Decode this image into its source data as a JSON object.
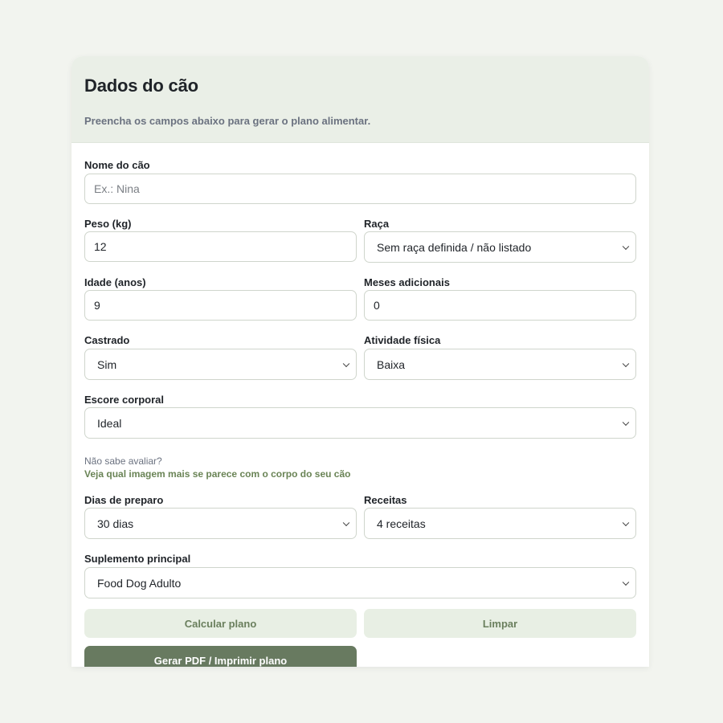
{
  "header": {
    "title": "Dados do cão",
    "subtitle": "Preencha os campos abaixo para gerar o plano alimentar."
  },
  "form": {
    "nome": {
      "label": "Nome do cão",
      "placeholder": "Ex.: Nina",
      "value": ""
    },
    "peso": {
      "label": "Peso (kg)",
      "value": "12"
    },
    "raca": {
      "label": "Raça",
      "value": "Sem raça definida / não listado"
    },
    "idade": {
      "label": "Idade (anos)",
      "value": "9"
    },
    "meses": {
      "label": "Meses adicionais",
      "value": "0"
    },
    "castrado": {
      "label": "Castrado",
      "value": "Sim"
    },
    "atividade": {
      "label": "Atividade física",
      "value": "Baixa"
    },
    "escore": {
      "label": "Escore corporal",
      "value": "Ideal"
    },
    "escore_hint": {
      "question": "Não sabe avaliar?",
      "link": "Veja qual imagem mais se parece com o corpo do seu cão"
    },
    "dias": {
      "label": "Dias de preparo",
      "value": "30 dias"
    },
    "receitas": {
      "label": "Receitas",
      "value": "4 receitas"
    },
    "suplemento": {
      "label": "Suplemento principal",
      "value": "Food Dog Adulto"
    }
  },
  "buttons": {
    "calcular": "Calcular plano",
    "limpar": "Limpar",
    "pdf": "Gerar PDF / Imprimir plano"
  }
}
